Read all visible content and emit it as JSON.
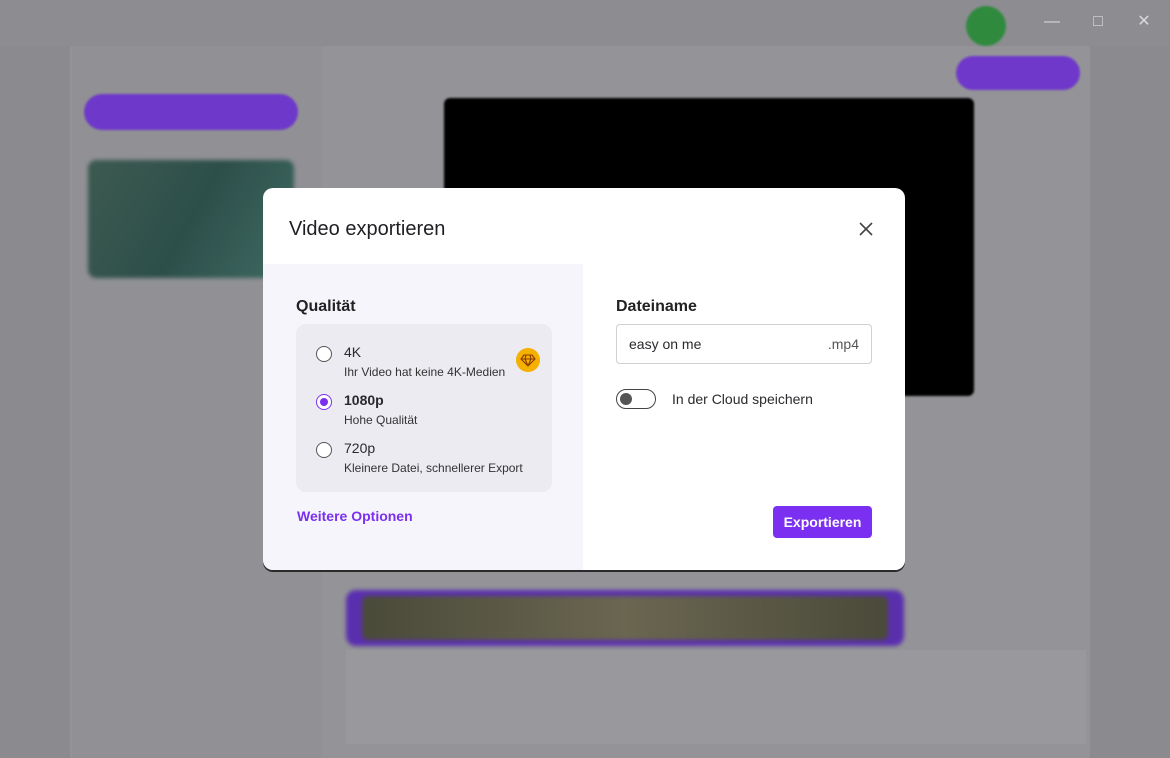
{
  "dialog": {
    "title": "Video exportieren",
    "quality": {
      "label": "Qualität",
      "options": [
        {
          "title": "4K",
          "subtitle": "Ihr Video hat keine 4K-Medien",
          "selected": false,
          "premium_icon": "diamond-icon"
        },
        {
          "title": "1080p",
          "subtitle": "Hohe Qualität",
          "selected": true
        },
        {
          "title": "720p",
          "subtitle": "Kleinere Datei, schnellerer Export",
          "selected": false
        }
      ],
      "more_options": "Weitere Optionen"
    },
    "filename": {
      "label": "Dateiname",
      "value": "easy on me",
      "extension": ".mp4"
    },
    "cloud": {
      "label": "In der Cloud speichern",
      "enabled": false
    },
    "export_button": "Exportieren"
  },
  "colors": {
    "accent": "#7b2ff0",
    "premium": "#f5b000"
  }
}
